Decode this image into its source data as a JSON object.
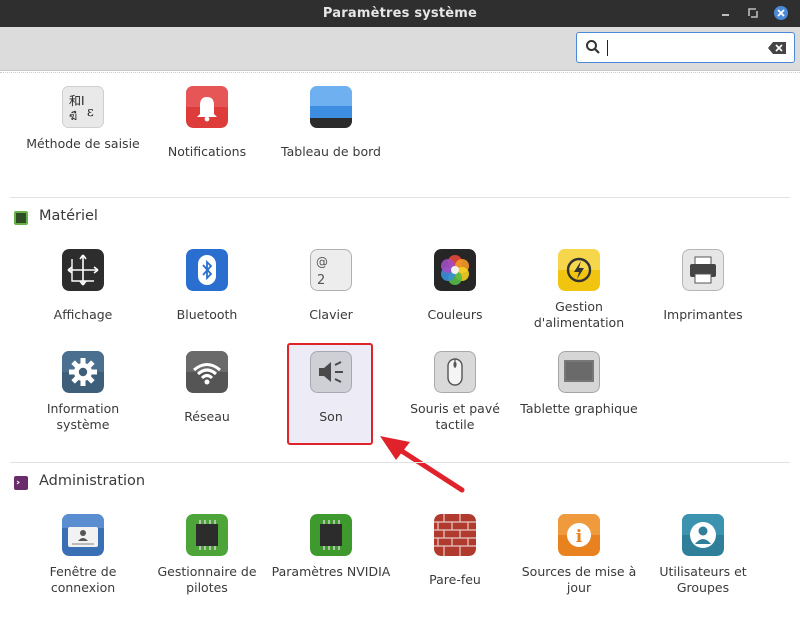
{
  "window": {
    "title": "Paramètres système"
  },
  "search": {
    "value": "",
    "placeholder": ""
  },
  "personal": {
    "items": [
      {
        "label": "Méthode de saisie",
        "icon": "input-method-icon"
      },
      {
        "label": "Notifications",
        "icon": "bell-icon"
      },
      {
        "label": "Tableau de bord",
        "icon": "panel-icon"
      }
    ]
  },
  "hardware": {
    "title": "Matériel",
    "color": "#5da03c",
    "items": [
      {
        "label": "Affichage",
        "icon": "display-icon"
      },
      {
        "label": "Bluetooth",
        "icon": "bluetooth-icon"
      },
      {
        "label": "Clavier",
        "icon": "keyboard-icon"
      },
      {
        "label": "Couleurs",
        "icon": "color-wheel-icon"
      },
      {
        "label": "Gestion d'alimentation",
        "icon": "power-icon"
      },
      {
        "label": "Imprimantes",
        "icon": "printer-icon"
      },
      {
        "label": "Information système",
        "icon": "gear-icon"
      },
      {
        "label": "Réseau",
        "icon": "wifi-icon"
      },
      {
        "label": "Son",
        "icon": "speaker-icon",
        "highlighted": true
      },
      {
        "label": "Souris et pavé tactile",
        "icon": "mouse-icon"
      },
      {
        "label": "Tablette graphique",
        "icon": "tablet-icon"
      }
    ]
  },
  "administration": {
    "title": "Administration",
    "color": "#6b2c6b",
    "items": [
      {
        "label": "Fenêtre de connexion",
        "icon": "login-window-icon"
      },
      {
        "label": "Gestionnaire de pilotes",
        "icon": "chip-icon"
      },
      {
        "label": "Paramètres NVIDIA",
        "icon": "nvidia-chip-icon"
      },
      {
        "label": "Pare-feu",
        "icon": "firewall-icon"
      },
      {
        "label": "Sources de mise à jour",
        "icon": "info-icon"
      },
      {
        "label": "Utilisateurs et Groupes",
        "icon": "users-icon"
      }
    ]
  },
  "colors": {
    "accent": "#4a8ad8",
    "highlight_border": "#e0232b",
    "arrow": "#e0232b"
  }
}
